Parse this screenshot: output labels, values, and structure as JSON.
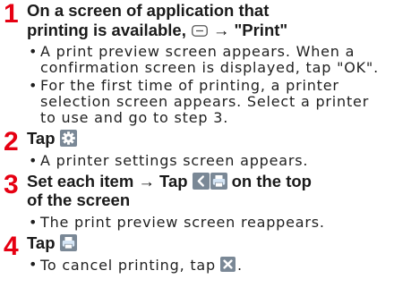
{
  "steps": [
    {
      "number": "1",
      "title": {
        "before_icon": "On a screen of application that\nprinting is available,",
        "icon": "menu-icon",
        "after_icon": "→ \"Print\""
      },
      "notes": [
        {
          "text": "A print preview screen appears. When a\nconfirmation screen is displayed, tap \"OK\"."
        },
        {
          "text": "For the first time of printing, a printer\nselection screen appears. Select a printer\nto use and go to step 3."
        }
      ]
    },
    {
      "number": "2",
      "title": {
        "before_icon": "Tap",
        "icon": "gear-icon"
      },
      "notes": [
        {
          "text": "A printer settings screen appears."
        }
      ]
    },
    {
      "number": "3",
      "title": {
        "before_icon": "Set each item → Tap",
        "icons": [
          "back-icon",
          "print-icon"
        ],
        "after_icon": "on the top\nof the screen"
      },
      "notes": [
        {
          "text": "The print preview screen reappears."
        }
      ]
    },
    {
      "number": "4",
      "title": {
        "before_icon": "Tap",
        "icon": "print-icon"
      },
      "notes": [
        {
          "before_icon": "To cancel printing, tap",
          "icon": "close-icon",
          "after_icon": "."
        }
      ]
    }
  ],
  "bullet_glyph": "•",
  "colors": {
    "step_number": "#e60012",
    "text": "#1a1a1a",
    "icon_tile": "#7a8896"
  }
}
